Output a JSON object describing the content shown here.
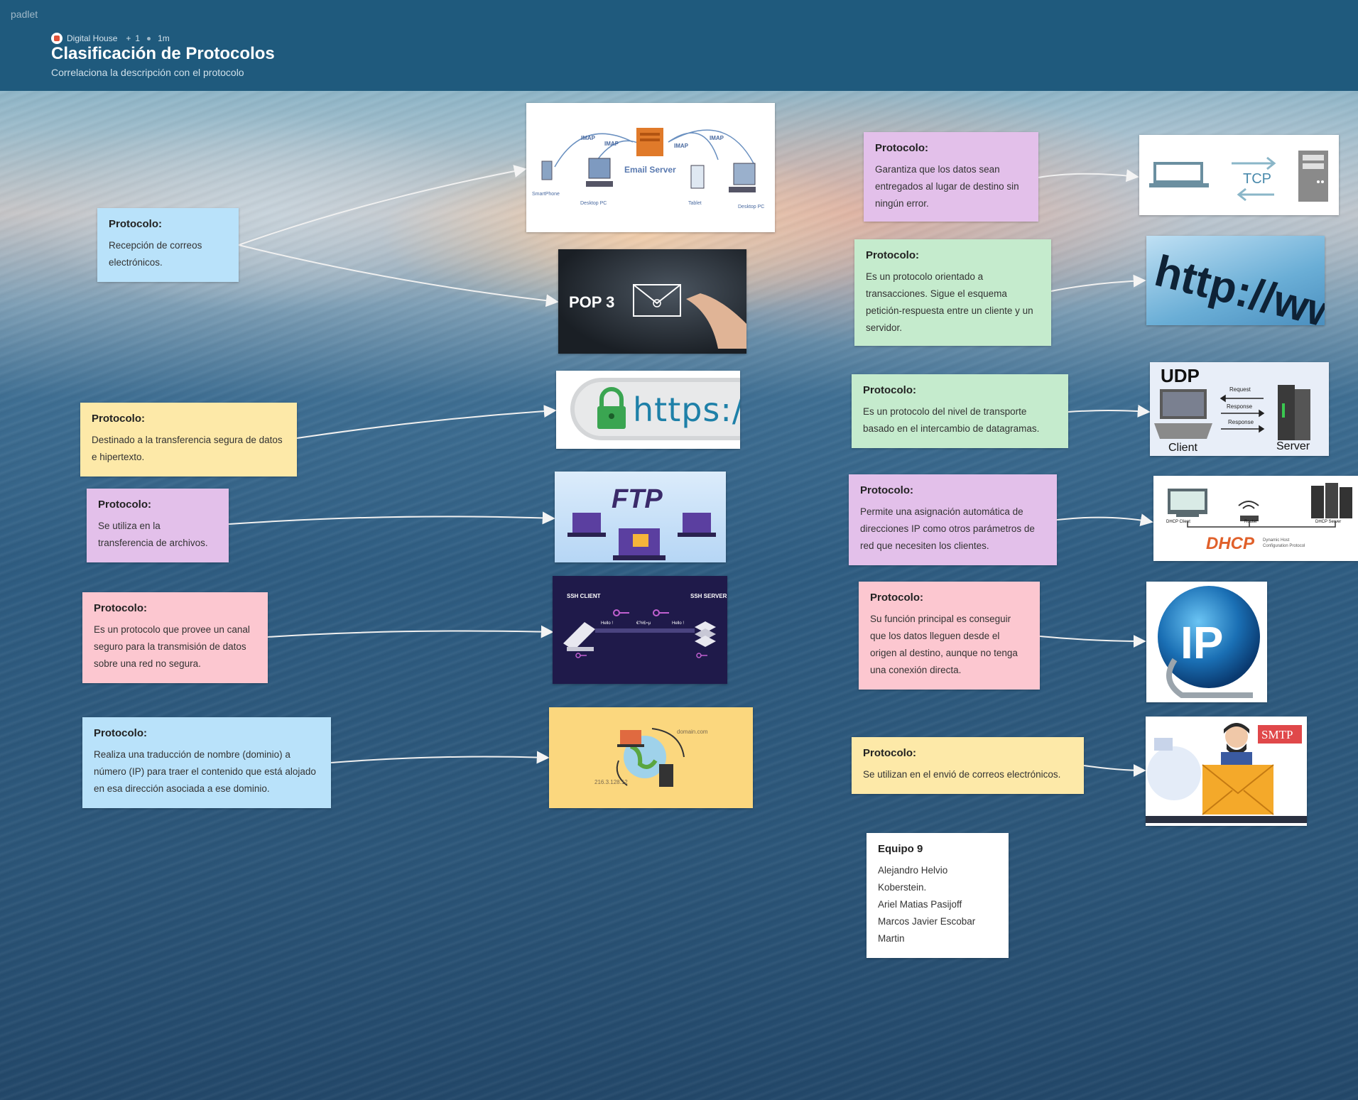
{
  "header": {
    "logo": "padlet",
    "org": "Digital House",
    "plus": "+",
    "members": "1",
    "time": "1m",
    "title": "Clasificación de Protocolos",
    "subtitle": "Correlaciona la descripción con el protocolo"
  },
  "cards": {
    "imap": {
      "title": "Protocolo:",
      "body": "Recepción de correos electrónicos."
    },
    "https": {
      "title": "Protocolo:",
      "body": "Destinado a la transferencia segura de datos e hipertexto."
    },
    "ftp": {
      "title": "Protocolo:",
      "body": "Se utiliza en la transferencia de archivos."
    },
    "ssh": {
      "title": "Protocolo:",
      "body": "Es un protocolo que provee un canal seguro para la transmisión de datos sobre una red no segura."
    },
    "dns": {
      "title": "Protocolo:",
      "body": "Realiza una traducción de nombre (dominio) a número (IP) para traer el contenido que está alojado en esa dirección asociada a ese dominio."
    },
    "tcp": {
      "title": "Protocolo:",
      "body": "Garantiza que los datos sean entregados al lugar de destino sin ningún error."
    },
    "http": {
      "title": "Protocolo:",
      "body": "Es un protocolo orientado a transacciones. Sigue el esquema petición-respuesta entre un cliente y un servidor."
    },
    "udp": {
      "title": "Protocolo:",
      "body": "Es un protocolo del nivel de transporte basado en el intercambio de datagramas."
    },
    "dhcp": {
      "title": "Protocolo:",
      "body": "Permite una asignación automática de direcciones IP como otros parámetros de red que necesiten los clientes."
    },
    "ip": {
      "title": "Protocolo:",
      "body": "Su función principal es conseguir que los datos lleguen desde el origen al destino, aunque no tenga una conexión directa."
    },
    "smtp": {
      "title": "Protocolo:",
      "body": "Se utilizan en el envió de correos electrónicos."
    },
    "team": {
      "title": "Equipo 9",
      "members": [
        "Alejandro Helvio Koberstein.",
        "Ariel Matias Pasijoff",
        "Marcos Javier Escobar Martin"
      ]
    }
  },
  "images": {
    "imap": {
      "imap_labels": [
        "IMAP",
        "IMAP",
        "IMAP",
        "IMAP"
      ],
      "server": "Email Server",
      "devices": [
        "SmartPhone",
        "Desktop PC",
        "Tablet",
        "Desktop PC"
      ]
    },
    "pop3": {
      "label": "POP 3"
    },
    "https": {
      "label": "https://"
    },
    "ftp": {
      "label": "FTP"
    },
    "ssh": {
      "client": "SSH CLIENT",
      "server": "SSH SERVER",
      "hello1": "Hello !",
      "hello2": "Hello !",
      "mid": "€?#£≈µ"
    },
    "dns": {
      "domain": "domain.com",
      "ip": "216.3.128.12"
    },
    "tcp": {
      "label": "TCP"
    },
    "http": {
      "label": "http://ww"
    },
    "udp": {
      "label": "UDP",
      "request": "Request",
      "response1": "Response",
      "response2": "Response",
      "client": "Client",
      "server": "Server"
    },
    "dhcp": {
      "client": "DHCP Client",
      "router": "Router",
      "server": "DHCP Server",
      "label": "DHCP",
      "desc1": "Dynamic Host",
      "desc2": "Configuration Protocol"
    },
    "ip": {
      "label": "IP"
    },
    "smtp": {
      "label": "SMTP"
    }
  },
  "colors": {
    "header": "#1f5a7d",
    "blue": "#b9e2fa",
    "yellow": "#fde9a8",
    "purple": "#e3c0ea",
    "pink": "#fcc7d0",
    "green": "#c5ebcd"
  }
}
